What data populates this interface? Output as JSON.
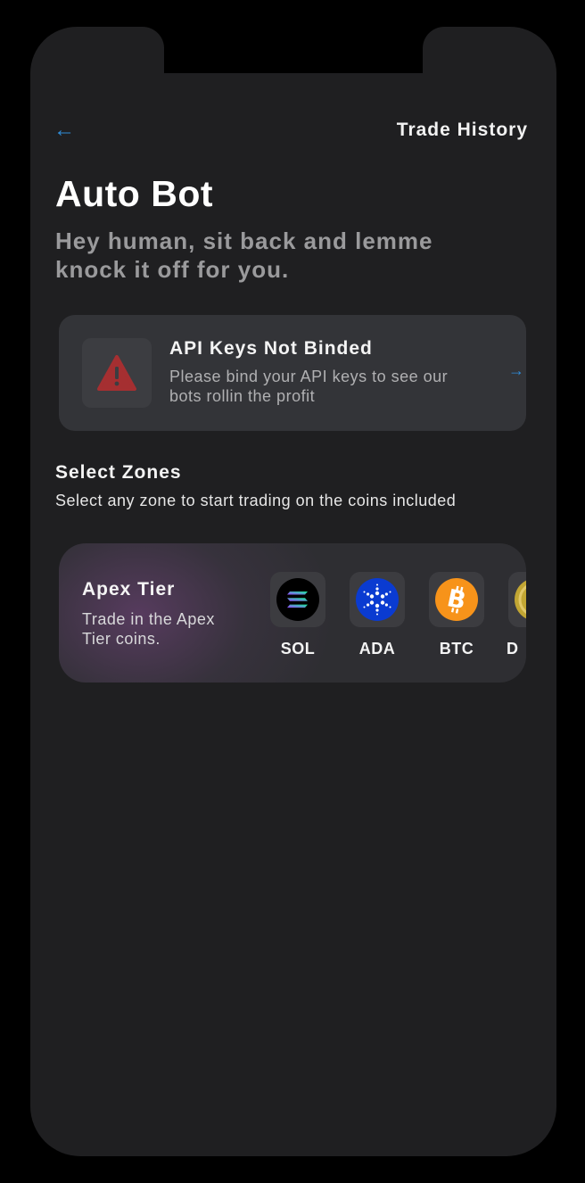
{
  "header": {
    "back_label": "←",
    "trade_history_label": "Trade History"
  },
  "page": {
    "title": "Auto Bot",
    "subtitle": "Hey human, sit back and lemme knock it off for you."
  },
  "api_card": {
    "title": "API Keys Not Binded",
    "description": "Please bind your API keys to see our bots rollin the profit",
    "icon": "warning-triangle-icon",
    "arrow": "→",
    "accent_color": "#b23333"
  },
  "zones": {
    "title": "Select Zones",
    "description": "Select any zone to start trading on the coins included",
    "items": [
      {
        "name": "Apex Tier",
        "description": "Trade in the Apex Tier coins.",
        "coins": [
          {
            "symbol": "SOL",
            "icon": "solana-icon",
            "color": "#000000"
          },
          {
            "symbol": "ADA",
            "icon": "cardano-icon",
            "color": "#0033ad"
          },
          {
            "symbol": "BTC",
            "icon": "bitcoin-icon",
            "color": "#f7931a"
          },
          {
            "symbol": "D",
            "icon": "dogecoin-icon",
            "color": "#c2a633"
          }
        ]
      }
    ]
  },
  "colors": {
    "background": "#1f1f21",
    "link": "#2f8cd8",
    "card": "#333438"
  }
}
